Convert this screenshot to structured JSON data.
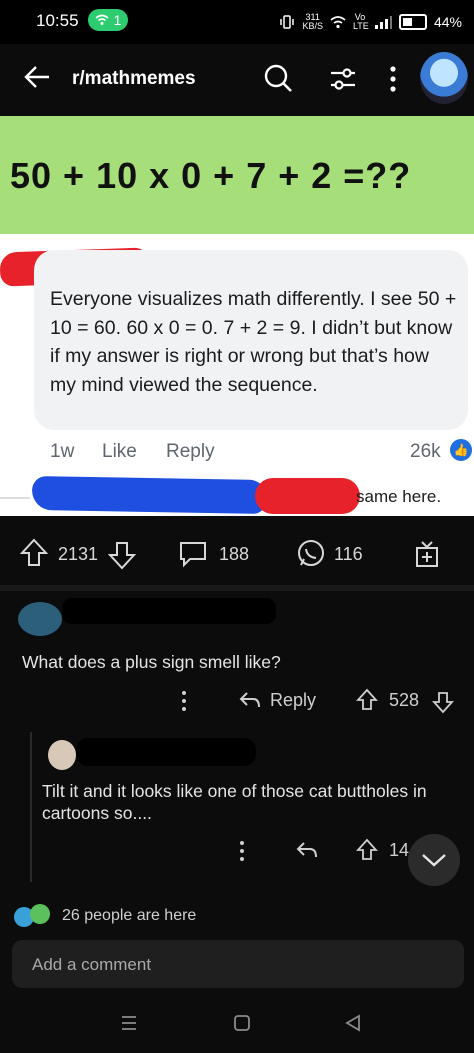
{
  "status_bar": {
    "time": "10:55",
    "wifi_badge": "1",
    "net_speed_value": "311",
    "net_speed_unit": "KB/S",
    "volte": "Vo LTE",
    "battery": "44%"
  },
  "app_bar": {
    "title": "r/mathmemes",
    "icons": [
      "back-arrow-icon",
      "search-icon",
      "filter-icon",
      "more-vert-icon",
      "avatar"
    ]
  },
  "post": {
    "equation": "50 + 10 x 0 + 7 + 2 =??",
    "quoted_comment": "Everyone visualizes math differently. I see 50 + 10 = 60. 60 x 0 = 0. 7 + 2 = 9. I didn’t but know if my answer is right or wrong but that’s how my mind viewed the sequence.",
    "quoted_age": "1w",
    "quoted_like": "Like",
    "quoted_reply": "Reply",
    "quoted_likes_count": "26k",
    "reply_preview": "same here."
  },
  "actions": {
    "upvotes": "2131",
    "comments": "188",
    "shares": "116"
  },
  "comments": [
    {
      "text": "What does a plus sign smell like?",
      "reply_label": "Reply",
      "score": "528"
    },
    {
      "text": "Tilt it and it looks like one of those cat buttholes in cartoons so....",
      "score": "14"
    }
  ],
  "presence": "26 people are here",
  "add_comment_placeholder": "Add a comment",
  "colors": {
    "green_banner": "#a6df7a",
    "like_blue": "#1f6fe0",
    "background": "#0c0c0c"
  }
}
